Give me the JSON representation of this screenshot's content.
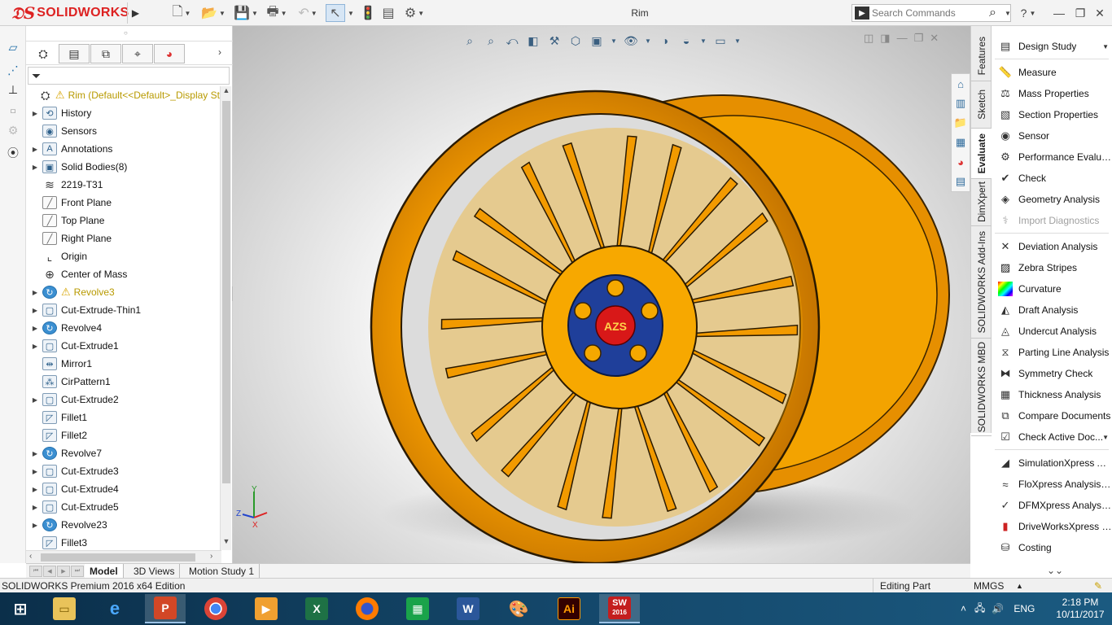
{
  "app": {
    "brand": "SOLIDWORKS",
    "window_title": "Rim",
    "search_placeholder": "Search Commands"
  },
  "feature_tree": {
    "root": "Rim  (Default<<Default>_Display St",
    "items": [
      {
        "label": "History",
        "expand": true,
        "icon": "history-icon",
        "glyph": "⟲"
      },
      {
        "label": "Sensors",
        "expand": false,
        "icon": "sensor-icon",
        "glyph": "◉"
      },
      {
        "label": "Annotations",
        "expand": true,
        "icon": "annotations-icon",
        "glyph": "A"
      },
      {
        "label": "Solid Bodies(8)",
        "expand": true,
        "icon": "solid-bodies-icon",
        "glyph": "▣"
      },
      {
        "label": "2219-T31",
        "expand": false,
        "icon": "material-icon",
        "glyph": "≋"
      },
      {
        "label": "Front Plane",
        "expand": false,
        "icon": "plane-icon",
        "glyph": "╱"
      },
      {
        "label": "Top Plane",
        "expand": false,
        "icon": "plane-icon",
        "glyph": "╱"
      },
      {
        "label": "Right Plane",
        "expand": false,
        "icon": "plane-icon",
        "glyph": "╱"
      },
      {
        "label": "Origin",
        "expand": false,
        "icon": "origin-icon",
        "glyph": "⌞"
      },
      {
        "label": "Center of Mass",
        "expand": false,
        "icon": "center-of-mass-icon",
        "glyph": "⊕"
      },
      {
        "label": "Revolve3",
        "expand": true,
        "icon": "revolve-icon",
        "glyph": "↻",
        "warning": true
      },
      {
        "label": "Cut-Extrude-Thin1",
        "expand": true,
        "icon": "cut-extrude-icon",
        "glyph": "▢"
      },
      {
        "label": "Revolve4",
        "expand": true,
        "icon": "revolve-icon",
        "glyph": "↻"
      },
      {
        "label": "Cut-Extrude1",
        "expand": true,
        "icon": "cut-extrude-icon",
        "glyph": "▢"
      },
      {
        "label": "Mirror1",
        "expand": false,
        "icon": "mirror-icon",
        "glyph": "⇹"
      },
      {
        "label": "CirPattern1",
        "expand": false,
        "icon": "circular-pattern-icon",
        "glyph": "⁂"
      },
      {
        "label": "Cut-Extrude2",
        "expand": true,
        "icon": "cut-extrude-icon",
        "glyph": "▢"
      },
      {
        "label": "Fillet1",
        "expand": false,
        "icon": "fillet-icon",
        "glyph": "◸"
      },
      {
        "label": "Fillet2",
        "expand": false,
        "icon": "fillet-icon",
        "glyph": "◸"
      },
      {
        "label": "Revolve7",
        "expand": true,
        "icon": "revolve-icon",
        "glyph": "↻"
      },
      {
        "label": "Cut-Extrude3",
        "expand": true,
        "icon": "cut-extrude-icon",
        "glyph": "▢"
      },
      {
        "label": "Cut-Extrude4",
        "expand": true,
        "icon": "cut-extrude-icon",
        "glyph": "▢"
      },
      {
        "label": "Cut-Extrude5",
        "expand": true,
        "icon": "cut-extrude-icon",
        "glyph": "▢"
      },
      {
        "label": "Revolve23",
        "expand": true,
        "icon": "revolve-icon",
        "glyph": "↻"
      },
      {
        "label": "Fillet3",
        "expand": false,
        "icon": "fillet-icon",
        "glyph": "◸"
      }
    ]
  },
  "task_tabs": [
    "Features",
    "Sketch",
    "Evaluate",
    "DimXpert",
    "SOLIDWORKS Add-Ins",
    "SOLIDWORKS MBD"
  ],
  "evaluate_commands": [
    {
      "label": "Design Study",
      "icon": "design-study-icon",
      "glyph": "▤",
      "caret": true
    },
    {
      "label": "Measure",
      "icon": "measure-icon",
      "glyph": "📏"
    },
    {
      "label": "Mass Properties",
      "icon": "mass-properties-icon",
      "glyph": "⚖"
    },
    {
      "label": "Section Properties",
      "icon": "section-properties-icon",
      "glyph": "▧"
    },
    {
      "label": "Sensor",
      "icon": "sensor-icon",
      "glyph": "◉"
    },
    {
      "label": "Performance Evaluat...",
      "icon": "performance-icon",
      "glyph": "⚙"
    },
    {
      "label": "Check",
      "icon": "check-icon",
      "glyph": "✔"
    },
    {
      "label": "Geometry Analysis",
      "icon": "geometry-analysis-icon",
      "glyph": "◈"
    },
    {
      "label": "Import Diagnostics",
      "icon": "import-diagnostics-icon",
      "glyph": "⚕",
      "disabled": true
    },
    {
      "label": "Deviation Analysis",
      "icon": "deviation-icon",
      "glyph": "✕"
    },
    {
      "label": "Zebra Stripes",
      "icon": "zebra-icon",
      "glyph": "▨"
    },
    {
      "label": "Curvature",
      "icon": "curvature-icon",
      "glyph": "■"
    },
    {
      "label": "Draft Analysis",
      "icon": "draft-analysis-icon",
      "glyph": "◭"
    },
    {
      "label": "Undercut Analysis",
      "icon": "undercut-icon",
      "glyph": "◬"
    },
    {
      "label": "Parting Line Analysis",
      "icon": "parting-line-icon",
      "glyph": "⧖"
    },
    {
      "label": "Symmetry Check",
      "icon": "symmetry-icon",
      "glyph": "⧓"
    },
    {
      "label": "Thickness Analysis",
      "icon": "thickness-icon",
      "glyph": "▦"
    },
    {
      "label": "Compare Documents",
      "icon": "compare-icon",
      "glyph": "⧉"
    },
    {
      "label": "Check Active Doc...",
      "icon": "check-active-doc-icon",
      "glyph": "☑",
      "caret": true
    },
    {
      "label": "SimulationXpress An...",
      "icon": "simulation-icon",
      "glyph": "◢"
    },
    {
      "label": "FloXpress Analysis W...",
      "icon": "floxpress-icon",
      "glyph": "≈"
    },
    {
      "label": "DFMXpress Analysis ...",
      "icon": "dfm-icon",
      "glyph": "✓"
    },
    {
      "label": "DriveWorksXpress W...",
      "icon": "driveworks-icon",
      "glyph": "▮"
    },
    {
      "label": "Costing",
      "icon": "costing-icon",
      "glyph": "⛁"
    }
  ],
  "bottom_tabs": [
    "Model",
    "3D Views",
    "Motion Study 1"
  ],
  "status": {
    "left": "SOLIDWORKS Premium 2016 x64 Edition",
    "mode": "Editing Part",
    "units": "MMGS"
  },
  "taskbar": {
    "language": "ENG",
    "time": "2:18 PM",
    "date": "10/11/2017",
    "solidworks_badge": "2016"
  },
  "model": {
    "hub_text": "AZS",
    "rim_color": "#f5a000",
    "hub_color": "#1f3f9a",
    "cap_color": "#d81818"
  },
  "triad": {
    "x": "X",
    "y": "Y",
    "z": "Z"
  }
}
